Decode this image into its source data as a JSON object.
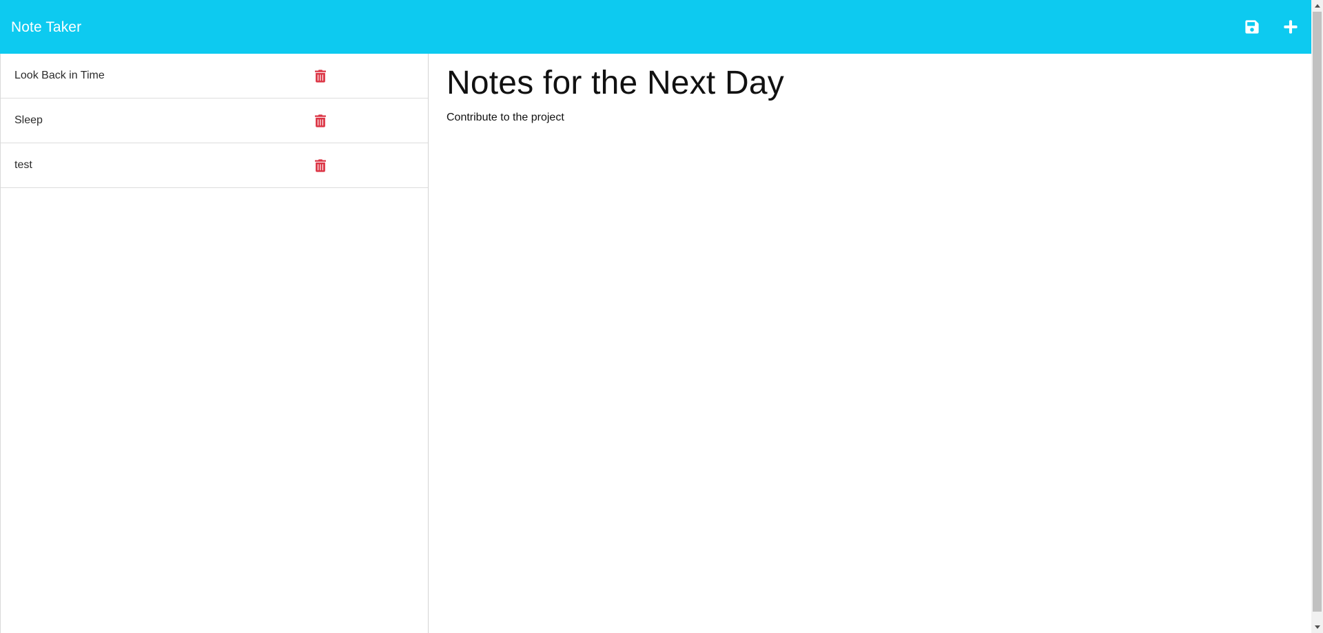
{
  "app": {
    "brand": "Note Taker",
    "accent_color": "#0dcaf0",
    "delete_color": "#dc3545"
  },
  "toolbar": {
    "save_icon": "save-icon",
    "new_icon": "plus-icon"
  },
  "notes": [
    {
      "title": "Look Back in Time"
    },
    {
      "title": "Sleep"
    },
    {
      "title": "test"
    }
  ],
  "active_note": {
    "title": "Notes for the Next Day",
    "text": "Contribute to the project"
  }
}
